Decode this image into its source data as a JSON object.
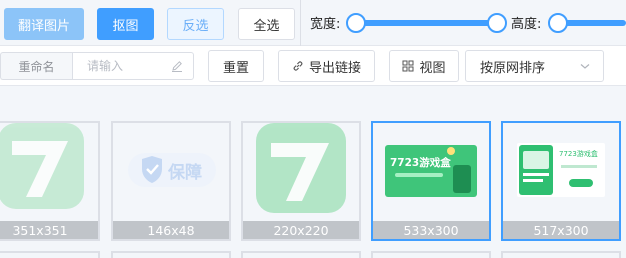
{
  "toolbar": {
    "translate_label": "翻译图片",
    "cutout_label": "抠图",
    "invert_label": "反选",
    "select_all_label": "全选",
    "width_label": "宽度:",
    "height_label": "高度:"
  },
  "actions": {
    "rename_prefix": "重命名",
    "rename_placeholder": "请输入",
    "reset_label": "重置",
    "export_link_label": "导出链接",
    "view_label": "视图",
    "sort_selected": "按原网排序"
  },
  "images": [
    {
      "size": "351x351",
      "selected": false,
      "icon": "7723-logo-icon"
    },
    {
      "size": "146x48",
      "selected": false,
      "icon": "shield-check-icon",
      "badge_text": "保障"
    },
    {
      "size": "220x220",
      "selected": false,
      "icon": "7723-logo-icon"
    },
    {
      "size": "533x300",
      "selected": true,
      "icon": "game-box-banner",
      "banner_text": "7723游戏盒"
    },
    {
      "size": "517x300",
      "selected": true,
      "icon": "game-box-phone",
      "banner_text": "7723游戏盒"
    }
  ],
  "colors": {
    "primary": "#409eff",
    "light_primary": "#8cc4f8",
    "brand_green": "#2fbf71",
    "background": "#f3f6fa"
  }
}
